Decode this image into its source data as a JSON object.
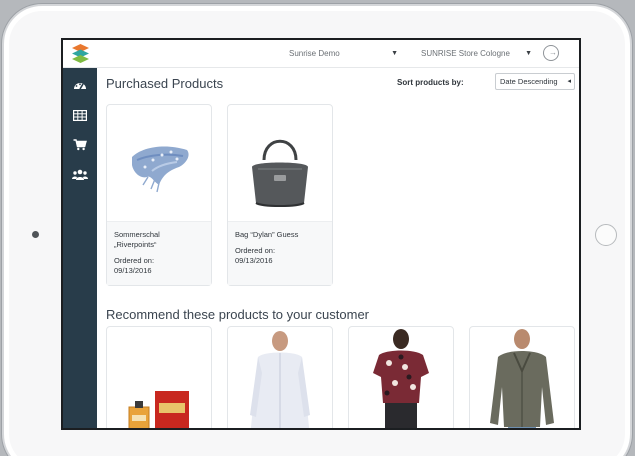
{
  "header": {
    "customer_select": "Sunrise Demo",
    "store_select": "SUNRISE Store Cologne"
  },
  "sidebar": {
    "items": [
      {
        "icon": "dashboard-icon"
      },
      {
        "icon": "table-icon"
      },
      {
        "icon": "cart-icon"
      },
      {
        "icon": "customers-icon"
      }
    ]
  },
  "main": {
    "title": "Purchased Products",
    "sort_label": "Sort products by:",
    "sort_value": "Date Descending",
    "purchased": [
      {
        "name_line1": "Sommerschal",
        "name_line2": "„Riverpoints“",
        "order_label": "Ordered on:",
        "order_date": "09/13/2016"
      },
      {
        "name_line1": "Bag “Dylan” Guess",
        "name_line2": "",
        "order_label": "Ordered on:",
        "order_date": "09/13/2016"
      }
    ],
    "recommend_title": "Recommend these products to your customer"
  },
  "colors": {
    "sidebar": "#283c4a",
    "frame": "#f7f7f8",
    "title_text": "#3b4550"
  }
}
